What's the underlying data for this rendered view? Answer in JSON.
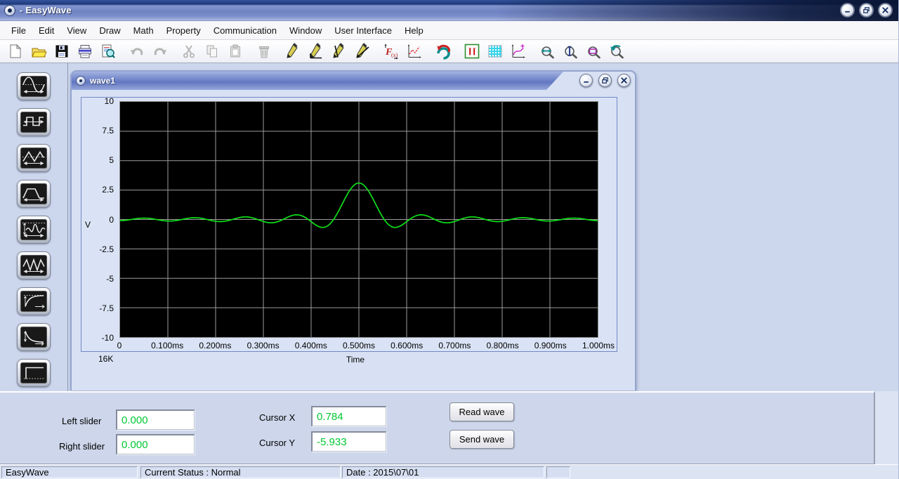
{
  "window": {
    "title": "- EasyWave"
  },
  "menu": {
    "items": [
      "File",
      "Edit",
      "View",
      "Draw",
      "Math",
      "Property",
      "Communication",
      "Window",
      "User Interface",
      "Help"
    ]
  },
  "toolbar": {
    "buttons": [
      {
        "name": "new-button",
        "icon": "new-document-icon",
        "enabled": true,
        "gap_before": false
      },
      {
        "name": "open-button",
        "icon": "open-folder-icon",
        "enabled": true,
        "gap_before": false
      },
      {
        "name": "save-button",
        "icon": "save-floppy-icon",
        "enabled": true,
        "gap_before": false
      },
      {
        "name": "print-button",
        "icon": "printer-icon",
        "enabled": true,
        "gap_before": false
      },
      {
        "name": "print-preview-button",
        "icon": "print-preview-icon",
        "enabled": true,
        "gap_before": false
      },
      {
        "name": "undo-button",
        "icon": "undo-arrow-icon",
        "enabled": false,
        "gap_before": true
      },
      {
        "name": "redo-button",
        "icon": "redo-arrow-icon",
        "enabled": false,
        "gap_before": false
      },
      {
        "name": "cut-button",
        "icon": "scissors-icon",
        "enabled": false,
        "gap_before": true
      },
      {
        "name": "copy-button",
        "icon": "copy-pages-icon",
        "enabled": false,
        "gap_before": false
      },
      {
        "name": "paste-button",
        "icon": "clipboard-icon",
        "enabled": false,
        "gap_before": false
      },
      {
        "name": "delete-button",
        "icon": "trash-icon",
        "enabled": false,
        "gap_before": true
      },
      {
        "name": "draw-freehand-button",
        "icon": "pencil-icon",
        "enabled": true,
        "gap_before": true
      },
      {
        "name": "draw-horizontal-line-button",
        "icon": "pencil-hline-icon",
        "enabled": true,
        "gap_before": false
      },
      {
        "name": "draw-vertical-line-button",
        "icon": "pencil-vline-icon",
        "enabled": true,
        "gap_before": false
      },
      {
        "name": "draw-diagonal-line-button",
        "icon": "pencil-diagonal-icon",
        "enabled": true,
        "gap_before": false
      },
      {
        "name": "function-editor-button",
        "icon": "function-fx-icon",
        "enabled": true,
        "gap_before": true
      },
      {
        "name": "coordinate-draw-button",
        "icon": "plot-red-dashed-icon",
        "enabled": true,
        "gap_before": false
      },
      {
        "name": "smooth-curve-button",
        "icon": "swoosh-arrow-icon",
        "enabled": true,
        "gap_before": true
      },
      {
        "name": "marker-cursors-button",
        "icon": "double-marker-icon",
        "enabled": true,
        "gap_before": true
      },
      {
        "name": "grid-toggle-button",
        "icon": "grid-icon",
        "enabled": true,
        "gap_before": false
      },
      {
        "name": "insert-plot-button",
        "icon": "plot-magenta-icon",
        "enabled": true,
        "gap_before": false
      },
      {
        "name": "zoom-horizontal-button",
        "icon": "zoom-horizontal-icon",
        "enabled": true,
        "gap_before": true
      },
      {
        "name": "zoom-vertical-button",
        "icon": "zoom-vertical-icon",
        "enabled": true,
        "gap_before": false
      },
      {
        "name": "zoom-box-button",
        "icon": "zoom-box-icon",
        "enabled": true,
        "gap_before": false
      },
      {
        "name": "zoom-reset-button",
        "icon": "zoom-back-icon",
        "enabled": true,
        "gap_before": false
      }
    ]
  },
  "sidebar": {
    "buttons": [
      {
        "name": "sine-wave-button",
        "icon": "sine-wave-icon"
      },
      {
        "name": "square-wave-button",
        "icon": "square-wave-icon"
      },
      {
        "name": "triangle-wave-button",
        "icon": "triangle-wave-icon"
      },
      {
        "name": "trapezoid-wave-button",
        "icon": "trapezoid-wave-icon"
      },
      {
        "name": "modulated-wave-button",
        "icon": "modulated-wave-icon"
      },
      {
        "name": "noise-wave-button",
        "icon": "zigzag-wave-icon"
      },
      {
        "name": "exp-rise-button",
        "icon": "exp-rise-icon"
      },
      {
        "name": "exp-decay-button",
        "icon": "exp-decay-icon"
      },
      {
        "name": "dc-level-button",
        "icon": "dc-level-icon"
      }
    ]
  },
  "wave_window": {
    "title": "wave1",
    "controls": [
      "minimize",
      "restore",
      "close"
    ]
  },
  "app_controls": [
    "minimize",
    "restore",
    "close"
  ],
  "chart_data": {
    "type": "line",
    "title": "wave1",
    "xlabel": "Time",
    "ylabel": "V",
    "sample_count_label": "16K",
    "x_tick_labels": [
      "0",
      "0.100ms",
      "0.200ms",
      "0.300ms",
      "0.400ms",
      "0.500ms",
      "0.600ms",
      "0.700ms",
      "0.800ms",
      "0.900ms",
      "1.000ms"
    ],
    "y_tick_labels": [
      "10",
      "7.5",
      "5",
      "2.5",
      "0",
      "-2.5",
      "-5",
      "-7.5",
      "-10"
    ],
    "xlim_ms": [
      0,
      1.0
    ],
    "ylim_v": [
      -10,
      10
    ],
    "grid": true,
    "plot_bg": "#000000",
    "grid_color": "#9c9c9c",
    "line_color": "#0ee018",
    "waveform": {
      "shape": "sinc",
      "baseline_v": 0,
      "amplitude_v": 3.1,
      "center_ms": 0.5,
      "zero_spacing_ms": 0.053
    },
    "samples_t_ms": [
      0,
      0.05,
      0.1,
      0.15,
      0.2,
      0.25,
      0.3,
      0.35,
      0.4,
      0.45,
      0.5,
      0.55,
      0.6,
      0.65,
      0.7,
      0.75,
      0.8,
      0.85,
      0.9,
      0.95,
      1.0
    ],
    "samples_v": [
      -0.1,
      0.12,
      -0.13,
      0.14,
      -0.15,
      0.16,
      -0.17,
      0.18,
      -0.18,
      0.19,
      3.1,
      0.19,
      -0.18,
      0.18,
      -0.17,
      0.16,
      -0.15,
      0.14,
      -0.13,
      0.12,
      -0.1
    ],
    "key_points": [
      {
        "t_ms": 0.5,
        "v": 3.1
      },
      {
        "t_ms": 0.427,
        "v": -0.65
      },
      {
        "t_ms": 0.574,
        "v": -0.65
      }
    ]
  },
  "bottom_panel": {
    "left_slider": {
      "label": "Left slider",
      "value": "0.000"
    },
    "right_slider": {
      "label": "Right slider",
      "value": "0.000"
    },
    "cursor_x": {
      "label": "Cursor X",
      "value": "0.784"
    },
    "cursor_y": {
      "label": "Cursor Y",
      "value": "-5.933"
    },
    "read_button": "Read wave",
    "send_button": "Send wave",
    "value_color": "#00c832"
  },
  "statusbar": {
    "segments": [
      "EasyWave",
      "Current Status : Normal",
      "Date : 2015\\07\\01",
      ""
    ]
  }
}
